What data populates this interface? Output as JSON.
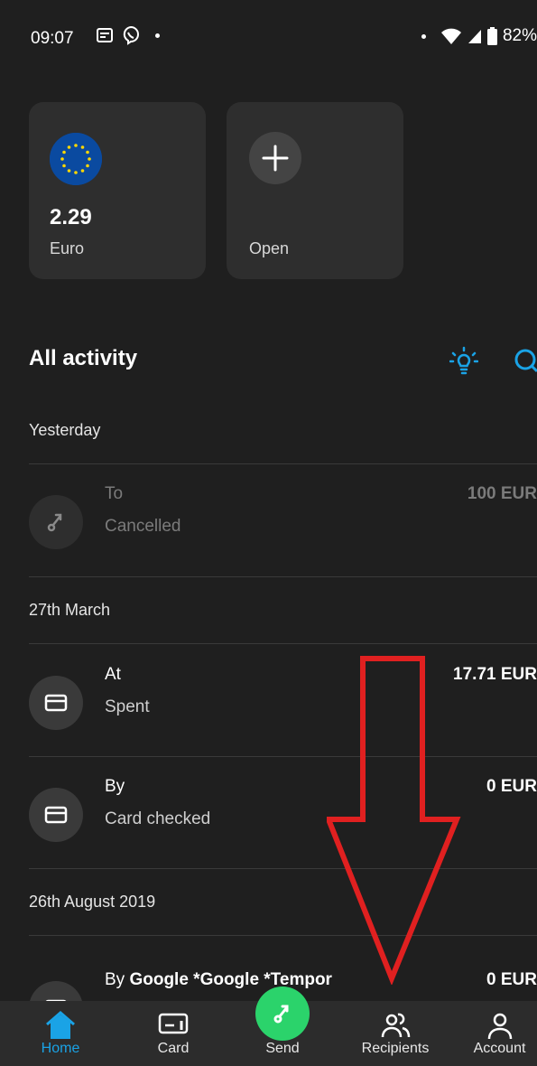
{
  "status_bar": {
    "time": "09:07",
    "battery": "82%",
    "icons": [
      "news-icon",
      "viber-icon",
      "dot-icon",
      "wifi-icon",
      "signal-icon",
      "battery-icon"
    ]
  },
  "balances": [
    {
      "amount": "2.29",
      "currency": "Euro",
      "icon": "eu-flag-icon"
    },
    {
      "label": "Open",
      "icon": "plus-icon"
    }
  ],
  "activity": {
    "title": "All activity",
    "actions": [
      "lightbulb-icon",
      "search-icon"
    ],
    "groups": [
      {
        "label": "Yesterday",
        "items": [
          {
            "title": "To",
            "subtitle": "Cancelled",
            "amount": "100 EUR",
            "icon": "send-arrow-icon",
            "state": "cancelled"
          }
        ]
      },
      {
        "label": "27th March",
        "items": [
          {
            "title": "At",
            "subtitle": "Spent",
            "amount": "17.71 EUR",
            "icon": "card-icon"
          },
          {
            "title": "By",
            "subtitle": "Card checked",
            "amount": "0 EUR",
            "icon": "card-icon"
          }
        ]
      },
      {
        "label": "26th August 2019",
        "items": [
          {
            "title_prefix": "By ",
            "title_bold": "Google *Google *Tempor",
            "amount": "0 EUR",
            "icon": "card-icon"
          }
        ]
      }
    ]
  },
  "nav": {
    "items": [
      {
        "label": "Home",
        "icon": "home-icon",
        "active": true
      },
      {
        "label": "Card",
        "icon": "card-icon"
      },
      {
        "label": "Send",
        "icon": "send-arrow-icon"
      },
      {
        "label": "Recipients",
        "icon": "recipients-icon"
      },
      {
        "label": "Account",
        "icon": "account-icon"
      }
    ]
  },
  "colors": {
    "background": "#1f1f1f",
    "card": "#2e2e2e",
    "accent_blue": "#1aa3e6",
    "send_green": "#2bd36b",
    "annotation_red": "#e02020"
  }
}
